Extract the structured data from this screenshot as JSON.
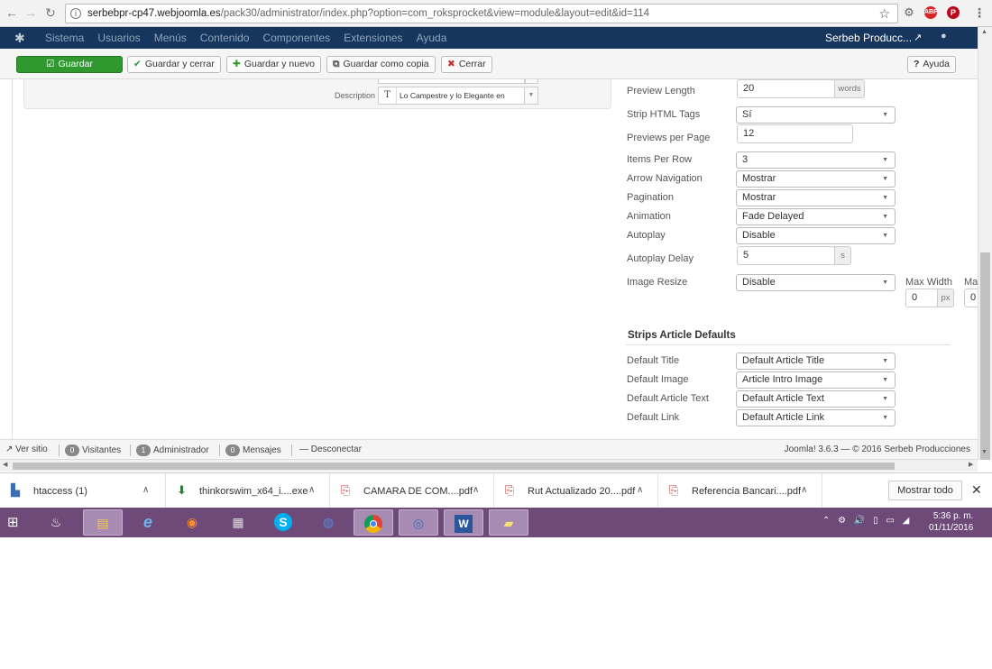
{
  "browser": {
    "url_host": "serbebpr-cp47.webjoomla.es",
    "url_path": "/pack30/administrator/index.php?option=com_roksprocket&view=module&layout=edit&id=114",
    "extensions": [
      "ABP"
    ]
  },
  "joomla_bar": {
    "menu": [
      "Sistema",
      "Usuarios",
      "Menús",
      "Contenido",
      "Componentes",
      "Extensiones",
      "Ayuda"
    ],
    "site_name": "Serbeb Producc..."
  },
  "toolbar": {
    "save": "Guardar",
    "save_close": "Guardar y cerrar",
    "save_new": "Guardar y nuevo",
    "save_copy": "Guardar como copia",
    "close": "Cerrar",
    "help": "Ayuda"
  },
  "left_panel": {
    "description_label": "Description",
    "description_value": "Lo Campestre y lo Elegante en"
  },
  "options": {
    "preview_length": {
      "label": "Preview Length",
      "value": "20",
      "unit": "words"
    },
    "strip_html": {
      "label": "Strip HTML Tags",
      "value": "Sí"
    },
    "previews_per_page": {
      "label": "Previews per Page",
      "value": "12"
    },
    "items_per_row": {
      "label": "Items Per Row",
      "value": "3"
    },
    "arrow_navigation": {
      "label": "Arrow Navigation",
      "value": "Mostrar"
    },
    "pagination": {
      "label": "Pagination",
      "value": "Mostrar"
    },
    "animation": {
      "label": "Animation",
      "value": "Fade Delayed"
    },
    "autoplay": {
      "label": "Autoplay",
      "value": "Disable"
    },
    "autoplay_delay": {
      "label": "Autoplay Delay",
      "value": "5",
      "unit": "s"
    },
    "image_resize": {
      "label": "Image Resize",
      "value": "Disable",
      "max_width_label": "Max Width",
      "max_width_value": "0",
      "max_width_unit": "px",
      "max_height_label": "Ma",
      "max_height_value": "0"
    }
  },
  "defaults": {
    "title": "Strips Article Defaults",
    "default_title": {
      "label": "Default Title",
      "value": "Default Article Title"
    },
    "default_image": {
      "label": "Default Image",
      "value": "Article Intro Image"
    },
    "default_text": {
      "label": "Default Article Text",
      "value": "Default Article Text"
    },
    "default_link": {
      "label": "Default Link",
      "value": "Default Article Link"
    }
  },
  "status": {
    "view_site": "Ver sitio",
    "visitors_count": "0",
    "visitors": "Visitantes",
    "admin_count": "1",
    "admin": "Administrador",
    "messages_count": "0",
    "messages": "Mensajes",
    "logout": "Desconectar",
    "copyright": "Joomla! 3.6.3 — © 2016 Serbeb Producciones"
  },
  "downloads": {
    "items": [
      "htaccess (1)",
      "thinkorswim_x64_i....exe",
      "CAMARA DE COM....pdf",
      "Rut Actualizado 20....pdf",
      "Referencia Bancari....pdf"
    ],
    "show_all": "Mostrar todo"
  },
  "taskbar": {
    "time": "5:36 p. m.",
    "date": "01/11/2016"
  },
  "colors": {
    "joomla_bar": "#17365d",
    "save_green": "#2f9930",
    "taskbar": "#6e4a78"
  }
}
